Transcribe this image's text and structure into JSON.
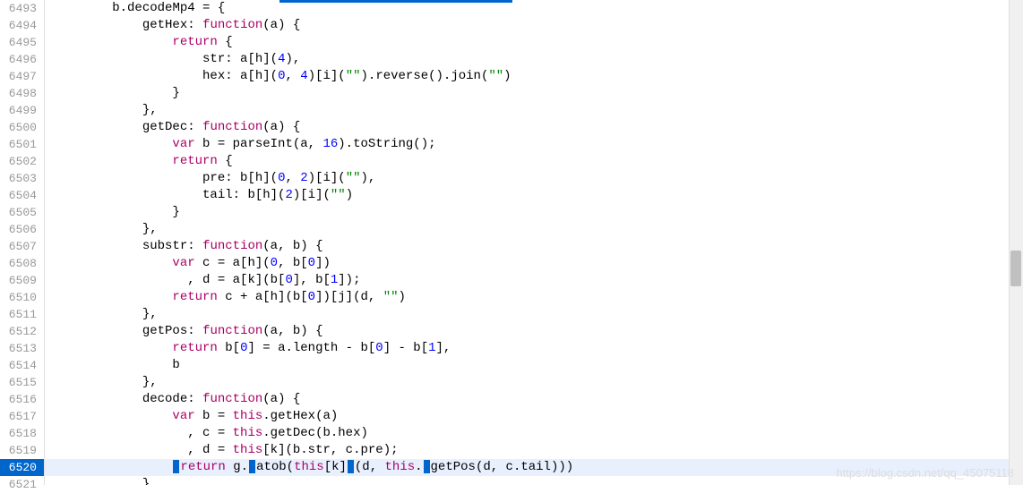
{
  "watermark": "https://blog.csdn.net/qq_45075118",
  "lines": [
    {
      "num": "6493",
      "indent": 8,
      "tokens": [
        [
          "ident",
          "b"
        ],
        [
          "punct",
          "."
        ],
        [
          "prop",
          "decodeMp4"
        ],
        [
          "punct",
          " = {"
        ]
      ]
    },
    {
      "num": "6494",
      "indent": 12,
      "tokens": [
        [
          "prop",
          "getHex"
        ],
        [
          "punct",
          ": "
        ],
        [
          "kw",
          "function"
        ],
        [
          "punct",
          "(a) {"
        ]
      ]
    },
    {
      "num": "6495",
      "indent": 16,
      "tokens": [
        [
          "ret",
          "return"
        ],
        [
          "punct",
          " {"
        ]
      ]
    },
    {
      "num": "6496",
      "indent": 20,
      "tokens": [
        [
          "prop",
          "str"
        ],
        [
          "punct",
          ": a[h]("
        ],
        [
          "num",
          "4"
        ],
        [
          "punct",
          "),"
        ]
      ]
    },
    {
      "num": "6497",
      "indent": 20,
      "tokens": [
        [
          "prop",
          "hex"
        ],
        [
          "punct",
          ": a[h]("
        ],
        [
          "num",
          "0"
        ],
        [
          "punct",
          ", "
        ],
        [
          "num",
          "4"
        ],
        [
          "punct",
          ")[i]("
        ],
        [
          "str",
          "\"\""
        ],
        [
          "punct",
          ").reverse().join("
        ],
        [
          "str",
          "\"\""
        ],
        [
          "punct",
          ")"
        ]
      ]
    },
    {
      "num": "6498",
      "indent": 16,
      "tokens": [
        [
          "punct",
          "}"
        ]
      ]
    },
    {
      "num": "6499",
      "indent": 12,
      "tokens": [
        [
          "punct",
          "},"
        ]
      ]
    },
    {
      "num": "6500",
      "indent": 12,
      "tokens": [
        [
          "prop",
          "getDec"
        ],
        [
          "punct",
          ": "
        ],
        [
          "kw",
          "function"
        ],
        [
          "punct",
          "(a) {"
        ]
      ]
    },
    {
      "num": "6501",
      "indent": 16,
      "tokens": [
        [
          "var",
          "var"
        ],
        [
          "punct",
          " b = parseInt(a, "
        ],
        [
          "num",
          "16"
        ],
        [
          "punct",
          ").toString();"
        ]
      ]
    },
    {
      "num": "6502",
      "indent": 16,
      "tokens": [
        [
          "ret",
          "return"
        ],
        [
          "punct",
          " {"
        ]
      ]
    },
    {
      "num": "6503",
      "indent": 20,
      "tokens": [
        [
          "prop",
          "pre"
        ],
        [
          "punct",
          ": b[h]("
        ],
        [
          "num",
          "0"
        ],
        [
          "punct",
          ", "
        ],
        [
          "num",
          "2"
        ],
        [
          "punct",
          ")[i]("
        ],
        [
          "str",
          "\"\""
        ],
        [
          "punct",
          "),"
        ]
      ]
    },
    {
      "num": "6504",
      "indent": 20,
      "tokens": [
        [
          "prop",
          "tail"
        ],
        [
          "punct",
          ": b[h]("
        ],
        [
          "num",
          "2"
        ],
        [
          "punct",
          ")[i]("
        ],
        [
          "str",
          "\"\""
        ],
        [
          "punct",
          ")"
        ]
      ]
    },
    {
      "num": "6505",
      "indent": 16,
      "tokens": [
        [
          "punct",
          "}"
        ]
      ]
    },
    {
      "num": "6506",
      "indent": 12,
      "tokens": [
        [
          "punct",
          "},"
        ]
      ]
    },
    {
      "num": "6507",
      "indent": 12,
      "tokens": [
        [
          "prop",
          "substr"
        ],
        [
          "punct",
          ": "
        ],
        [
          "kw",
          "function"
        ],
        [
          "punct",
          "(a, b) {"
        ]
      ]
    },
    {
      "num": "6508",
      "indent": 16,
      "tokens": [
        [
          "var",
          "var"
        ],
        [
          "punct",
          " c = a[h]("
        ],
        [
          "num",
          "0"
        ],
        [
          "punct",
          ", b["
        ],
        [
          "num",
          "0"
        ],
        [
          "punct",
          "])"
        ]
      ]
    },
    {
      "num": "6509",
      "indent": 18,
      "tokens": [
        [
          "punct",
          ", d = a[k](b["
        ],
        [
          "num",
          "0"
        ],
        [
          "punct",
          "], b["
        ],
        [
          "num",
          "1"
        ],
        [
          "punct",
          "]);"
        ]
      ]
    },
    {
      "num": "6510",
      "indent": 16,
      "tokens": [
        [
          "ret",
          "return"
        ],
        [
          "punct",
          " c + a[h](b["
        ],
        [
          "num",
          "0"
        ],
        [
          "punct",
          "])[j](d, "
        ],
        [
          "str",
          "\"\""
        ],
        [
          "punct",
          ")"
        ]
      ]
    },
    {
      "num": "6511",
      "indent": 12,
      "tokens": [
        [
          "punct",
          "},"
        ]
      ]
    },
    {
      "num": "6512",
      "indent": 12,
      "tokens": [
        [
          "prop",
          "getPos"
        ],
        [
          "punct",
          ": "
        ],
        [
          "kw",
          "function"
        ],
        [
          "punct",
          "(a, b) {"
        ]
      ]
    },
    {
      "num": "6513",
      "indent": 16,
      "tokens": [
        [
          "ret",
          "return"
        ],
        [
          "punct",
          " b["
        ],
        [
          "num",
          "0"
        ],
        [
          "punct",
          "] = a.length - b["
        ],
        [
          "num",
          "0"
        ],
        [
          "punct",
          "] - b["
        ],
        [
          "num",
          "1"
        ],
        [
          "punct",
          "],"
        ]
      ]
    },
    {
      "num": "6514",
      "indent": 16,
      "tokens": [
        [
          "punct",
          "b"
        ]
      ]
    },
    {
      "num": "6515",
      "indent": 12,
      "tokens": [
        [
          "punct",
          "},"
        ]
      ]
    },
    {
      "num": "6516",
      "indent": 12,
      "tokens": [
        [
          "prop",
          "decode"
        ],
        [
          "punct",
          ": "
        ],
        [
          "kw",
          "function"
        ],
        [
          "punct",
          "(a) {"
        ]
      ]
    },
    {
      "num": "6517",
      "indent": 16,
      "tokens": [
        [
          "var",
          "var"
        ],
        [
          "punct",
          " b = "
        ],
        [
          "this",
          "this"
        ],
        [
          "punct",
          ".getHex(a)"
        ]
      ]
    },
    {
      "num": "6518",
      "indent": 18,
      "tokens": [
        [
          "punct",
          ", c = "
        ],
        [
          "this",
          "this"
        ],
        [
          "punct",
          ".getDec(b.hex)"
        ]
      ]
    },
    {
      "num": "6519",
      "indent": 18,
      "tokens": [
        [
          "punct",
          ", d = "
        ],
        [
          "this",
          "this"
        ],
        [
          "punct",
          "[k](b.str, c.pre);"
        ]
      ]
    },
    {
      "num": "6520",
      "indent": 16,
      "active": true,
      "tokens": [
        [
          "cursor",
          ""
        ],
        [
          "ret",
          "return"
        ],
        [
          "punct",
          " g."
        ],
        [
          "cursor",
          ""
        ],
        [
          "punct",
          "atob("
        ],
        [
          "this",
          "this"
        ],
        [
          "punct",
          "[k]"
        ],
        [
          "cursor",
          ""
        ],
        [
          "punct",
          "(d, "
        ],
        [
          "this",
          "this"
        ],
        [
          "punct",
          "."
        ],
        [
          "cursor",
          ""
        ],
        [
          "punct",
          "getPos(d, c.tail)))"
        ]
      ]
    },
    {
      "num": "6521",
      "indent": 12,
      "tokens": [
        [
          "punct",
          "}"
        ]
      ]
    }
  ]
}
